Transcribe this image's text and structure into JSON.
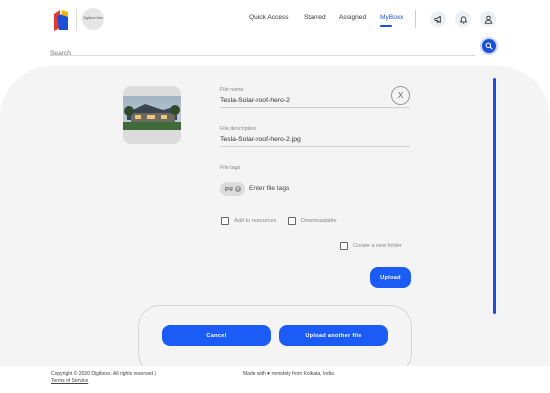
{
  "header": {
    "org_badge": "Digiboxx Now",
    "nav": [
      {
        "label": "Quick Access"
      },
      {
        "label": "Starred"
      },
      {
        "label": "Assigned"
      },
      {
        "label": "MyBoxx",
        "active": true
      }
    ],
    "icons": [
      "megaphone-icon",
      "bell-icon",
      "user-icon"
    ]
  },
  "search": {
    "placeholder": "Search"
  },
  "upload_form": {
    "file_name_label": "File name",
    "file_name_value": "Tesla-Solar-roof-hero-2",
    "file_description_label": "File description",
    "file_description_value": "Tesla-Solar-roof-hero-2.jpg",
    "file_tags_label": "File tags",
    "tags": [
      "jpg"
    ],
    "tag_input_placeholder": "Enter file tags",
    "close_label": "X",
    "add_to_resources_label": "Add to resources",
    "downloadable_label": "Downloadable",
    "create_folder_label": "Create a new folder",
    "upload_label": "Upload",
    "cancel_label": "Cancel",
    "upload_another_label": "Upload another file"
  },
  "footer": {
    "copyright": "Copyright © 2020 Digiboxx. All rights reserved |",
    "terms": "Terms of Service",
    "made_with": "Made with ♥ remotely from Kolkata, India"
  },
  "colors": {
    "accent": "#1a4fd6",
    "button": "#1a5cf5",
    "panel_bg": "#f4f4f4"
  }
}
